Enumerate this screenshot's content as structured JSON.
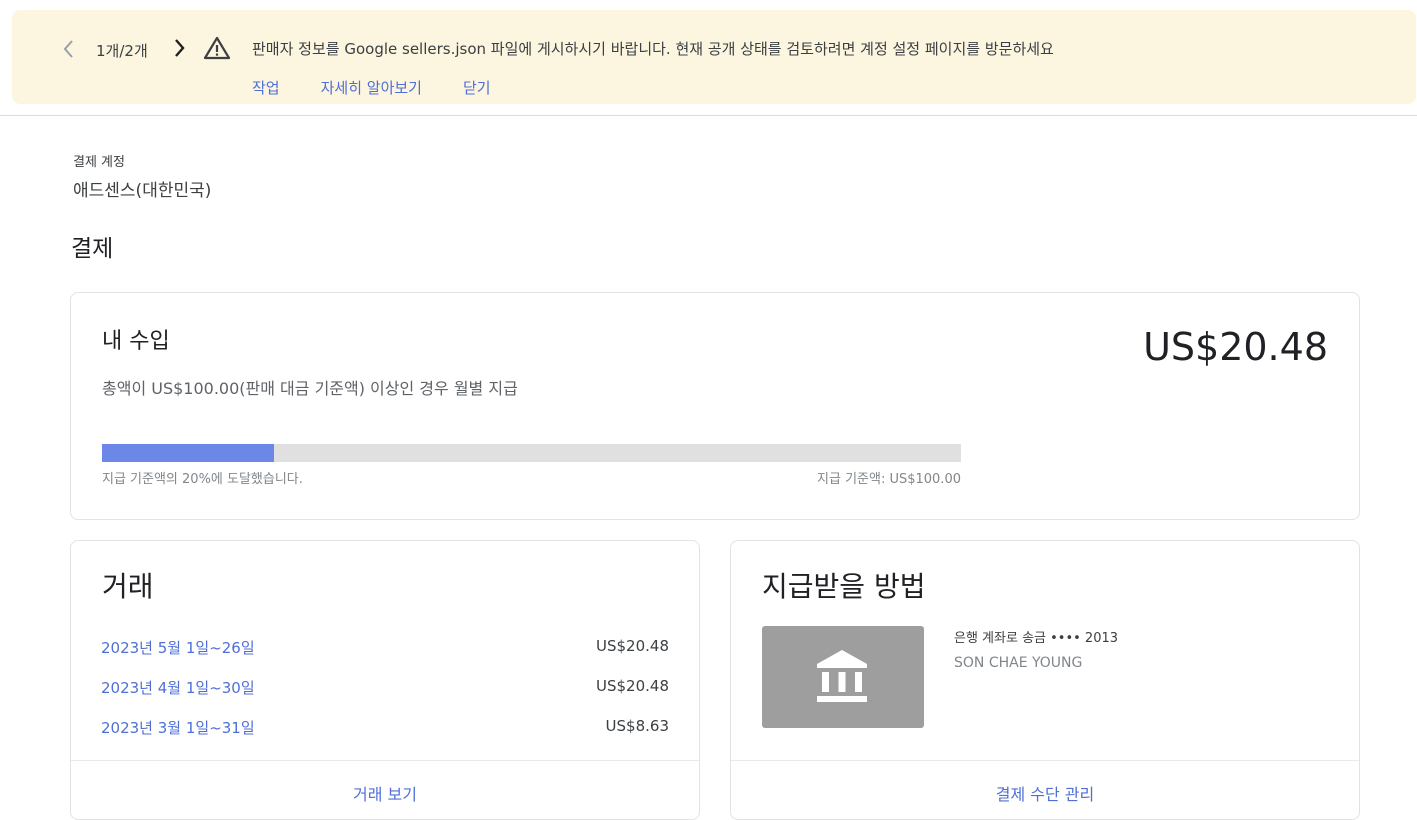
{
  "banner": {
    "pager": "1개/2개",
    "message": "판매자 정보를 Google sellers.json 파일에 게시하시기 바랍니다. 현재 공개 상태를 검토하려면 계정 설정 페이지를 방문하세요",
    "actions": [
      "작업",
      "자세히 알아보기",
      "닫기"
    ],
    "colors": {
      "background": "#fcf5e0",
      "link": "#4f6fd7"
    },
    "icons": {
      "prev": "chevron-left-icon",
      "next": "chevron-right-icon",
      "alert": "warning-icon"
    }
  },
  "account": {
    "label": "결제 계정",
    "name": "애드센스(대한민국)"
  },
  "page_title": "결제",
  "earnings": {
    "title": "내 수입",
    "subtitle": "총액이 US$100.00(판매 대금 기준액) 이상인 경우 월별 지급",
    "amount": "US$20.48",
    "progress_fraction": 0.2,
    "progress_text": "지급 기준액의 20%에 도달했습니다.",
    "threshold_text": "지급 기준액: US$100.00",
    "colors": {
      "fill": "#6b87e8",
      "track": "#e0e0e0"
    }
  },
  "transactions": {
    "title": "거래",
    "rows": [
      {
        "period": "2023년 5월 1일~26일",
        "amount": "US$20.48"
      },
      {
        "period": "2023년 4월 1일~30일",
        "amount": "US$20.48"
      },
      {
        "period": "2023년 3월 1일~31일",
        "amount": "US$8.63"
      }
    ],
    "footer_link": "거래 보기"
  },
  "payment_method": {
    "title": "지급받을 방법",
    "method": "은행 계좌로 송금 •••• 2013",
    "holder": "SON CHAE YOUNG",
    "icon": "bank-icon",
    "footer_link": "결제 수단 관리"
  }
}
